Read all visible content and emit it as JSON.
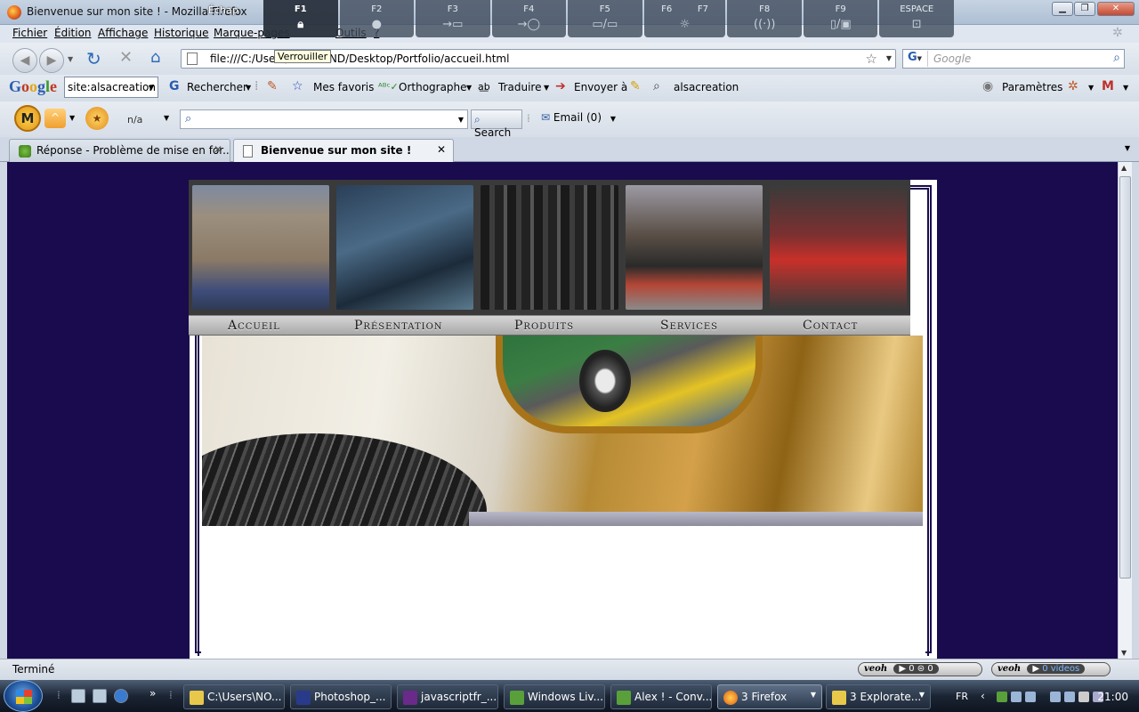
{
  "window": {
    "title": "Bienvenue sur mon site ! - Mozilla Firefox"
  },
  "overlay": {
    "schap": "Échap",
    "keys": [
      {
        "key": "F1",
        "icon": "lock-icon"
      },
      {
        "key": "F2",
        "icon": "search-icon"
      },
      {
        "key": "F3",
        "icon": "arrow-icon"
      },
      {
        "key": "F4",
        "icon": "disk-icon"
      },
      {
        "key": "F5",
        "icon": "display-icon"
      },
      {
        "key": "F6",
        "icon": "brightness-icon"
      },
      {
        "key": "F7",
        "icon": "brightness-icon"
      },
      {
        "key": "F8",
        "icon": "wireless-icon"
      },
      {
        "key": "F9",
        "icon": "device-icon"
      },
      {
        "key": "ESPACE",
        "icon": "zoom-icon"
      }
    ],
    "tooltip": "Verrouiller"
  },
  "menu": [
    "Fichier",
    "Édition",
    "Affichage",
    "Historique",
    "Marque-pages",
    "Outils",
    "?"
  ],
  "nav": {
    "url": "file:///C:/Users/NORMAND/Desktop/Portfolio/accueil.html",
    "search_placeholder": "Google"
  },
  "google_toolbar": {
    "logo": "Google",
    "site_select": "site:alsacreation",
    "rechercher": "Rechercher",
    "favoris": "Mes favoris",
    "orthographe": "Orthographe",
    "traduire": "Traduire",
    "envoyer": "Envoyer à",
    "alsacreation": "alsacreation",
    "parametres": "Paramètres"
  },
  "mcafee_bar": {
    "logo": "M",
    "na": "n/a",
    "search": "Search",
    "email": "Email (0)"
  },
  "tabs": [
    {
      "label": "Réponse - Problème de mise en for..."
    },
    {
      "label": "Bienvenue sur mon site !"
    }
  ],
  "site": {
    "nav": [
      "Accueil",
      "Présentation",
      "Produits",
      "Services",
      "Contact"
    ]
  },
  "status": {
    "text": "Terminé",
    "veoh1": {
      "logo": "veoh",
      "count1": "0",
      "count2": "0"
    },
    "veoh2": {
      "logo": "veoh",
      "videos": "0 videos"
    }
  },
  "taskbar": {
    "items": [
      {
        "label": "C:\\Users\\NO..."
      },
      {
        "label": "Photoshop_..."
      },
      {
        "label": "javascriptfr_..."
      },
      {
        "label": "Windows Liv..."
      },
      {
        "label": "Alex ! - Conv..."
      },
      {
        "label": "3 Firefox"
      },
      {
        "label": "3 Explorate..."
      }
    ],
    "lang": "FR",
    "clock": "21:00"
  },
  "colors": {
    "page_bg": "#1a0a4e",
    "accent": "#2e5ea0"
  }
}
